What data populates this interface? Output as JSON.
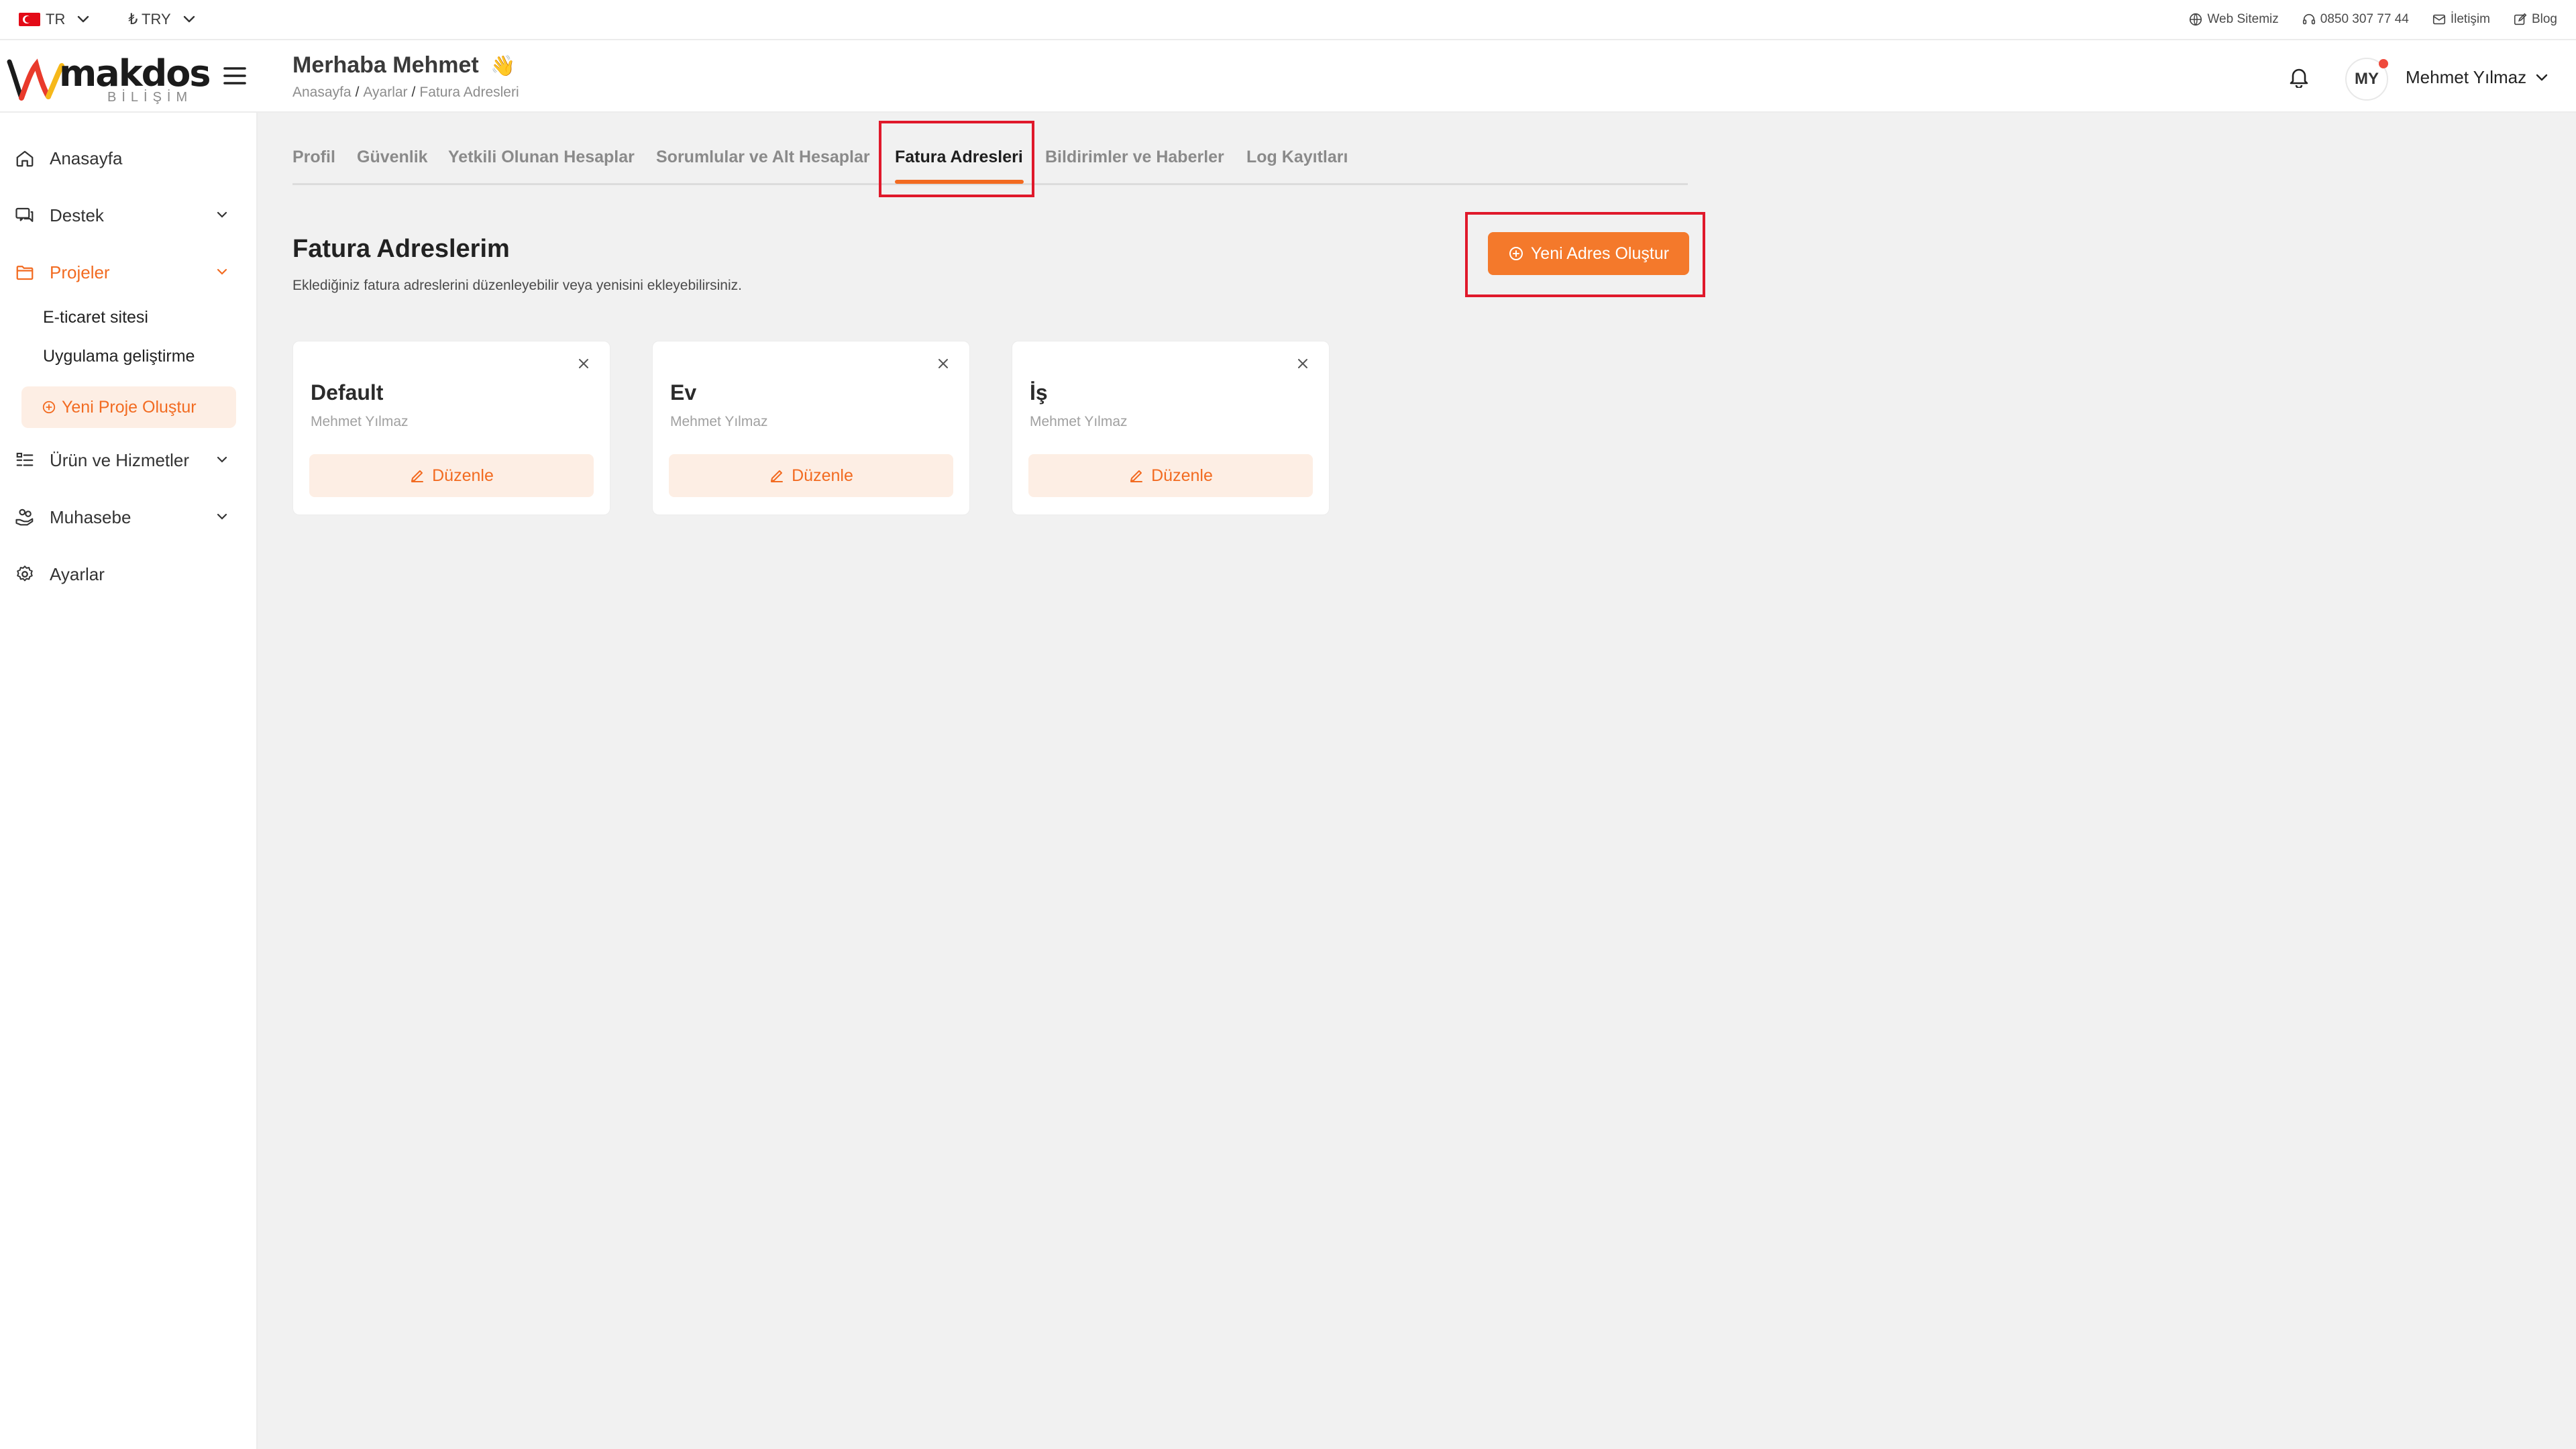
{
  "topbar": {
    "language": "TR",
    "currency": "₺ TRY",
    "links": [
      {
        "label": "Web Sitemiz",
        "icon": "globe-icon"
      },
      {
        "label": "0850 307 77 44",
        "icon": "headset-icon"
      },
      {
        "label": "İletişim",
        "icon": "mail-icon"
      },
      {
        "label": "Blog",
        "icon": "edit-icon"
      }
    ]
  },
  "header": {
    "logo_word": "makdos",
    "logo_sub": "BİLİŞİM",
    "greeting": "Merhaba Mehmet",
    "greeting_emoji": "👋",
    "breadcrumb": [
      "Anasayfa",
      "Ayarlar",
      "Fatura Adresleri"
    ],
    "avatar_initials": "MY",
    "user_name": "Mehmet Yılmaz"
  },
  "sidebar": {
    "items": [
      {
        "label": "Anasayfa",
        "icon": "home-icon"
      },
      {
        "label": "Destek",
        "icon": "chat-icon"
      },
      {
        "label": "Projeler",
        "icon": "folder-icon"
      },
      {
        "label": "Ürün ve Hizmetler",
        "icon": "list-icon"
      },
      {
        "label": "Muhasebe",
        "icon": "coins-hand-icon"
      },
      {
        "label": "Ayarlar",
        "icon": "gear-icon"
      }
    ],
    "project_sub_items": [
      "E-ticaret sitesi",
      "Uygulama geliştirme"
    ],
    "new_project_label": "Yeni Proje Oluştur"
  },
  "tabs": [
    "Profil",
    "Güvenlik",
    "Yetkili Olunan Hesaplar",
    "Sorumlular ve Alt Hesaplar",
    "Fatura Adresleri",
    "Bildirimler ve Haberler",
    "Log Kayıtları"
  ],
  "active_tab": "Fatura Adresleri",
  "section": {
    "title": "Fatura Adreslerim",
    "description": "Eklediğiniz fatura adreslerini düzenleyebilir veya yenisini ekleyebilirsiniz.",
    "new_button_label": "Yeni Adres Oluştur"
  },
  "addresses": [
    {
      "title": "Default",
      "owner": "Mehmet Yılmaz",
      "edit_label": "Düzenle"
    },
    {
      "title": "Ev",
      "owner": "Mehmet Yılmaz",
      "edit_label": "Düzenle"
    },
    {
      "title": "İş",
      "owner": "Mehmet Yılmaz",
      "edit_label": "Düzenle"
    }
  ],
  "colors": {
    "accent": "#f26b21",
    "accent_soft": "#fdeee4",
    "highlight": "#e0192b",
    "background": "#f1f1f1"
  }
}
